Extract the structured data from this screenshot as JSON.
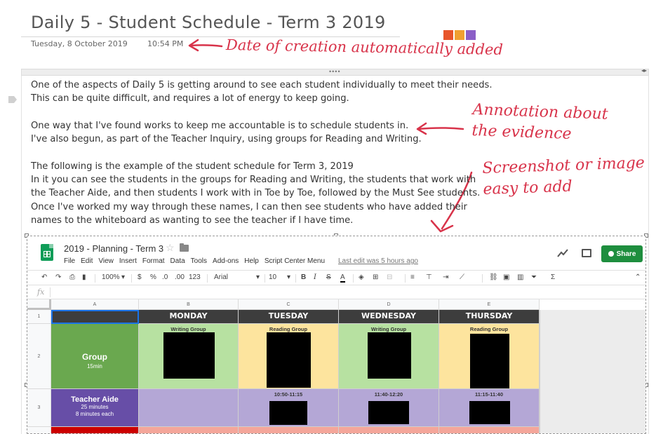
{
  "page": {
    "title": "Daily 5 - Student Schedule - Term 3 2019",
    "date": "Tuesday, 8 October 2019",
    "time": "10:54 PM",
    "tag_colors": [
      "#e8552a",
      "#f0a030",
      "#8b5fc7"
    ]
  },
  "annotations": {
    "created": "Date of creation automatically added",
    "evidence_line1": "Annotation about",
    "evidence_line2": "the evidence",
    "image_line1": "Screenshot or image",
    "image_line2": "easy to add",
    "color": "#d8334a"
  },
  "body": {
    "lines": [
      "One of the aspects of Daily 5 is getting around to see each student individually to meet their needs.",
      "This can be quite difficult, and requires a lot of energy to keep going.",
      "",
      "One way that I've found works to keep me accountable is to schedule students in.",
      "I've also begun, as part of the Teacher Inquiry, using groups for Reading and Writing.",
      "",
      "The following is the example of the student schedule for Term 3, 2019",
      "In it you can see the students in the groups for Reading and Writing,  the students that work with",
      "the Teacher Aide, and then students I work with in Toe by Toe, followed by the Must See students.",
      "Once I've worked my way through these names, I can then see students who have added their",
      "names to the whiteboard as wanting to see the teacher if I have time."
    ]
  },
  "sheet": {
    "doc_title": "2019 - Planning - Term 3",
    "menu": [
      "File",
      "Edit",
      "View",
      "Insert",
      "Format",
      "Data",
      "Tools",
      "Add-ons",
      "Help",
      "Script Center Menu"
    ],
    "last_edit": "Last edit was 5 hours ago",
    "share_label": "Share",
    "toolbar": {
      "zoom": "100%",
      "currency": "$",
      "percent": "%",
      "dec_less": ".0",
      "dec_more": ".00",
      "num_format": "123",
      "font": "Arial",
      "size": "10",
      "bold": "B",
      "italic": "I",
      "strike": "S",
      "text_color": "A"
    },
    "fx": "fx",
    "columns": [
      "A",
      "B",
      "C",
      "D",
      "E"
    ],
    "rows": [
      "1",
      "2",
      "3"
    ],
    "days": [
      "MONDAY",
      "TUESDAY",
      "WEDNESDAY",
      "THURSDAY"
    ],
    "group_label": "Group",
    "group_sub": "15min",
    "group_captions": [
      "Writing Group",
      "Reading Group",
      "Writing Group",
      "Reading Group"
    ],
    "aide_label": "Teacher Aide",
    "aide_sub1": "25 minutes",
    "aide_sub2": "8 minutes each",
    "aide_times": [
      "10:50-11:15",
      "11:40-12:20",
      "11:15-11:40"
    ]
  }
}
